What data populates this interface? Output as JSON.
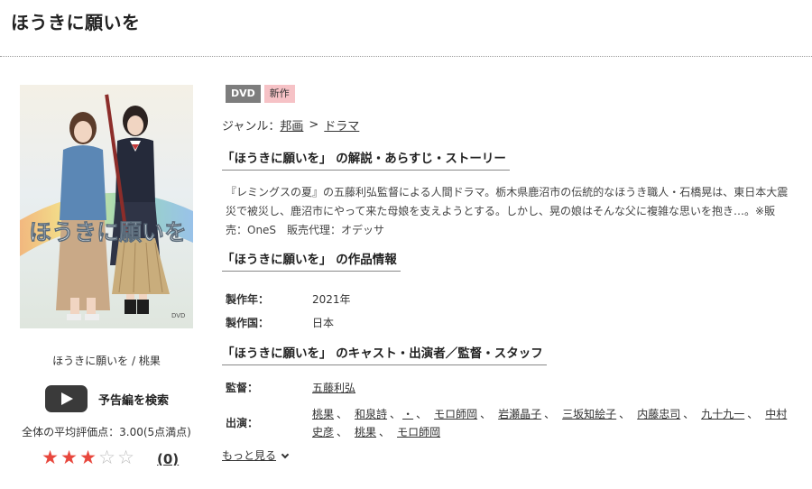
{
  "page": {
    "title": "ほうきに願いを"
  },
  "poster": {
    "title_art": "ほうきに願いを"
  },
  "left": {
    "caption": "ほうきに願いを / 桃果",
    "trailer_label": "予告編を検索",
    "rating_text": "全体の平均評価点：3.00(5点満点)",
    "rating_value": 3,
    "rating_max": 5,
    "review_count": "(0)"
  },
  "badges": {
    "format": "DVD",
    "new": "新作"
  },
  "genre": {
    "label": "ジャンル：",
    "parent": "邦画",
    "separator": ">",
    "child": "ドラマ"
  },
  "sections": {
    "synopsis_title": "「ほうきに願いを」 の解説・あらすじ・ストーリー",
    "info_title": "「ほうきに願いを」 の作品情報",
    "cast_title": "「ほうきに願いを」 のキャスト・出演者／監督・スタッフ"
  },
  "synopsis": "『レミングスの夏』の五藤利弘監督による人間ドラマ。栃木県鹿沼市の伝統的なほうき職人・石橋晃は、東日本大震災で被災し、鹿沼市にやって来た母娘を支えようとする。しかし、晃の娘はそんな父に複雑な思いを抱き…。※販売：OneS　販売代理：オデッサ",
  "info": [
    {
      "label": "製作年：",
      "value": "2021年"
    },
    {
      "label": "製作国：",
      "value": "日本"
    }
  ],
  "cast": {
    "director_label": "監督：",
    "director": "五藤利弘",
    "cast_label": "出演：",
    "members": [
      "桃果",
      "和泉詩",
      "・",
      "モロ師岡",
      "岩瀬晶子",
      "三坂知絵子",
      "内藤忠司",
      "九十九一",
      "中村史彦",
      "桃果",
      "モロ師岡"
    ],
    "separator": "、"
  },
  "more_label": "もっと見る",
  "colors": {
    "star_on": "#e8473d",
    "star_off": "#bdbdbd",
    "dvd_badge": "#7d7d7d",
    "new_badge": "#f6c2c6"
  }
}
